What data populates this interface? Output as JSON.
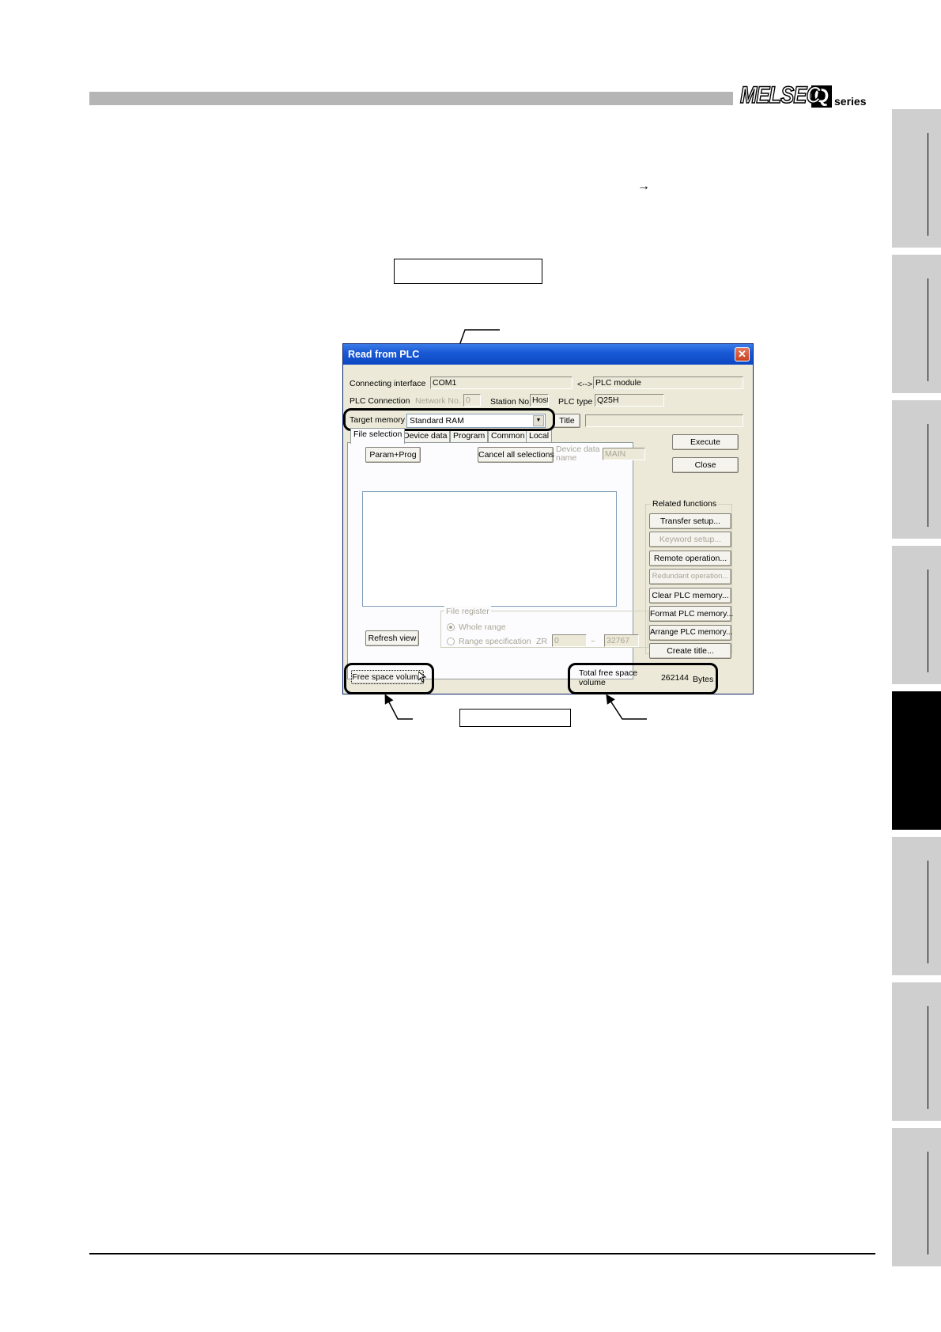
{
  "header": {
    "logo_main": "MELSEC",
    "logo_q": "Q",
    "logo_series": "series",
    "arrow_glyph": "→"
  },
  "dialog": {
    "title": "Read from PLC",
    "close_glyph": "✕",
    "connecting_interface_label": "Connecting interface",
    "connecting_interface_value": "COM1",
    "link_symbol": "<-->",
    "plc_module_value": "PLC module",
    "plc_connection_label": "PLC Connection",
    "network_no_label": "Network No.",
    "network_no_value": "0",
    "station_no_label": "Station No.",
    "station_no_value": "Host",
    "plc_type_label": "PLC type",
    "plc_type_value": "Q25H",
    "target_memory_label": "Target memory",
    "target_memory_value": "Standard RAM",
    "title_button": "Title",
    "title_value": "",
    "tabs": [
      "File selection",
      "Device data",
      "Program",
      "Common",
      "Local"
    ],
    "param_prog_button": "Param+Prog",
    "cancel_all_button": "Cancel all selections",
    "device_data_name_label": "Device data name",
    "device_data_name_value": "MAIN",
    "refresh_view_button": "Refresh view",
    "file_register": {
      "legend": "File register",
      "whole_range": "Whole range",
      "range_spec": "Range specification",
      "zr_label": "ZR",
      "from_value": "0",
      "tilde": "~",
      "to_value": "32767"
    },
    "execute_button": "Execute",
    "close_button": "Close",
    "related_functions": {
      "legend": "Related functions",
      "buttons": [
        "Transfer setup...",
        "Keyword setup...",
        "Remote operation...",
        "Redundant operation...",
        "Clear PLC memory...",
        "Format PLC memory...",
        "Arrange PLC memory...",
        "Create title..."
      ],
      "disabled": [
        false,
        true,
        false,
        true,
        false,
        false,
        false,
        false
      ]
    },
    "free_space_button": "Free space volume",
    "total_free_label_line1": "Total free space",
    "total_free_label_line2": "volume",
    "total_free_value": "262144",
    "total_free_unit": "Bytes"
  }
}
